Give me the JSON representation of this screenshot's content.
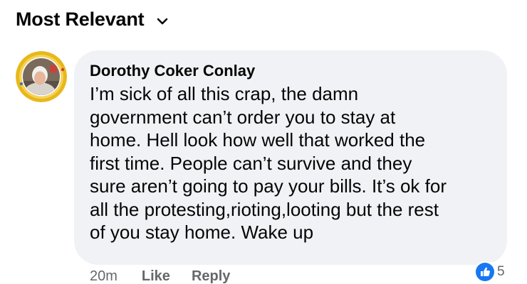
{
  "header": {
    "sort_label": "Most Relevant",
    "sort_icon": "chevron-down-icon"
  },
  "comment": {
    "author": "Dorothy Coker Conlay",
    "text": "I’m sick of all this crap, the damn\ngovernment can’t order you to stay at\nhome. Hell look how well that worked the\nfirst time. People can’t survive and they\nsure aren’t going to pay your bills. It’s ok for\nall the protesting,rioting,looting but the rest\nof you stay home. Wake up",
    "timestamp": "20m",
    "like_label": "Like",
    "reply_label": "Reply",
    "reaction_count": "5",
    "reaction_icon": "like-reaction-icon"
  },
  "colors": {
    "bubble_bg": "#f0f2f5",
    "secondary_text": "#65676b",
    "like_blue": "#1877f2",
    "avatar_ring": "#e8b81a"
  }
}
